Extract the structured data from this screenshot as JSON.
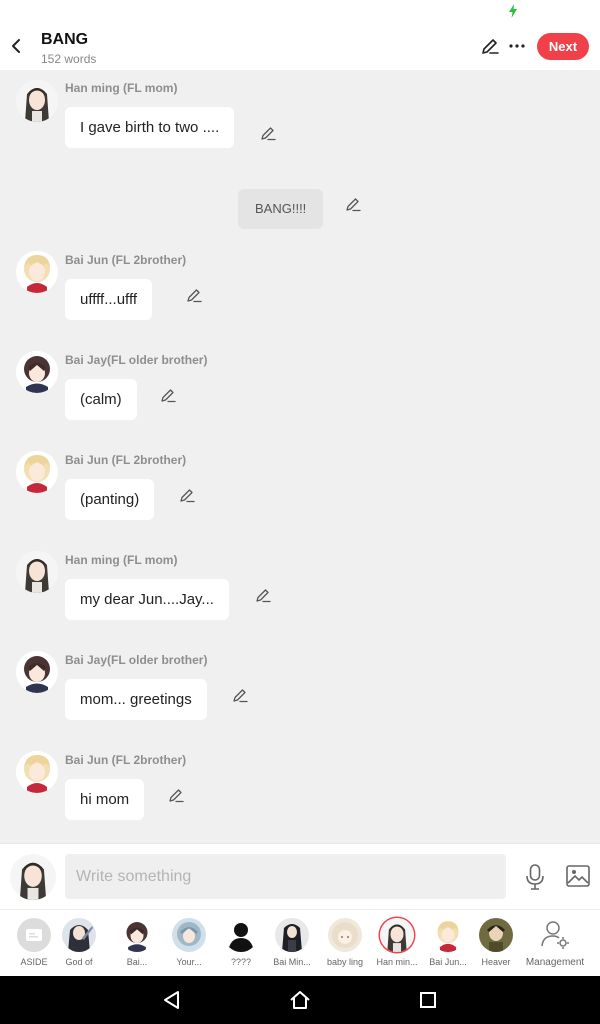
{
  "header": {
    "title": "BANG",
    "word_count": "152 words",
    "next_label": "Next"
  },
  "messages": [
    {
      "speaker": "Han ming (FL mom)",
      "text": "I gave birth to two ....",
      "avatar": "han-ming"
    },
    {
      "aside": true,
      "text": "BANG!!!!"
    },
    {
      "speaker": "Bai Jun (FL 2brother)",
      "text": "uffff...ufff",
      "avatar": "bai-jun"
    },
    {
      "speaker": "Bai Jay(FL older brother)",
      "text": "(calm)",
      "avatar": "bai-jay"
    },
    {
      "speaker": "Bai Jun (FL 2brother)",
      "text": "(panting)",
      "avatar": "bai-jun"
    },
    {
      "speaker": "Han ming (FL mom)",
      "text": "my dear Jun....Jay...",
      "avatar": "han-ming"
    },
    {
      "speaker": "Bai Jay(FL older brother)",
      "text": "mom... greetings",
      "avatar": "bai-jay"
    },
    {
      "speaker": "Bai Jun (FL 2brother)",
      "text": "hi mom",
      "avatar": "bai-jun"
    }
  ],
  "composer": {
    "placeholder": "Write something"
  },
  "characters": [
    {
      "label": "ASIDE",
      "avatar": "aside"
    },
    {
      "label": "God of",
      "avatar": "god-of"
    },
    {
      "label": "Bai...",
      "avatar": "bai-jay"
    },
    {
      "label": "Your...",
      "avatar": "your"
    },
    {
      "label": "????",
      "avatar": "silhouette"
    },
    {
      "label": "Bai Min...",
      "avatar": "bai-min"
    },
    {
      "label": "baby ling",
      "avatar": "baby-ling"
    },
    {
      "label": "Han min...",
      "avatar": "han-ming",
      "selected": true
    },
    {
      "label": "Bai Jun...",
      "avatar": "bai-jun"
    },
    {
      "label": "Heaver",
      "avatar": "heaver"
    }
  ],
  "management_label": "Management",
  "colors": {
    "accent": "#f0414a",
    "background": "#f0f0f0",
    "bubble": "#ffffff",
    "aside_bubble": "#e4e4e4",
    "charging_bolt": "#2bbf3b"
  }
}
